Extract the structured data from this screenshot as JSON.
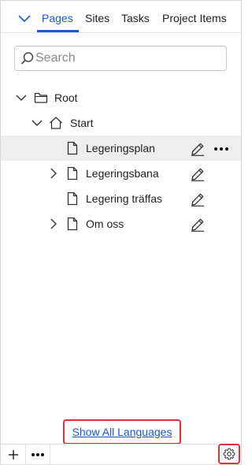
{
  "tabs": [
    {
      "label": "Pages",
      "active": true
    },
    {
      "label": "Sites",
      "active": false
    },
    {
      "label": "Tasks",
      "active": false
    },
    {
      "label": "Project Items",
      "active": false
    }
  ],
  "search": {
    "placeholder": "Search",
    "value": ""
  },
  "tree": [
    {
      "label": "Root",
      "icon": "folder-icon",
      "expander": "expanded"
    },
    {
      "label": "Start",
      "icon": "home-icon",
      "expander": "expanded"
    },
    {
      "label": "Legeringsplan",
      "icon": "page-icon",
      "expander": "none",
      "selected": true
    },
    {
      "label": "Legeringsbana",
      "icon": "page-icon",
      "expander": "collapsed"
    },
    {
      "label": "Legering träffas",
      "icon": "page-icon",
      "expander": "none"
    },
    {
      "label": "Om oss",
      "icon": "page-icon",
      "expander": "collapsed"
    }
  ],
  "footer": {
    "show_languages_label": "Show All Languages"
  },
  "colors": {
    "accent": "#1a57d6",
    "highlight_border": "#e0303a",
    "selected_row": "#eeeeee"
  }
}
